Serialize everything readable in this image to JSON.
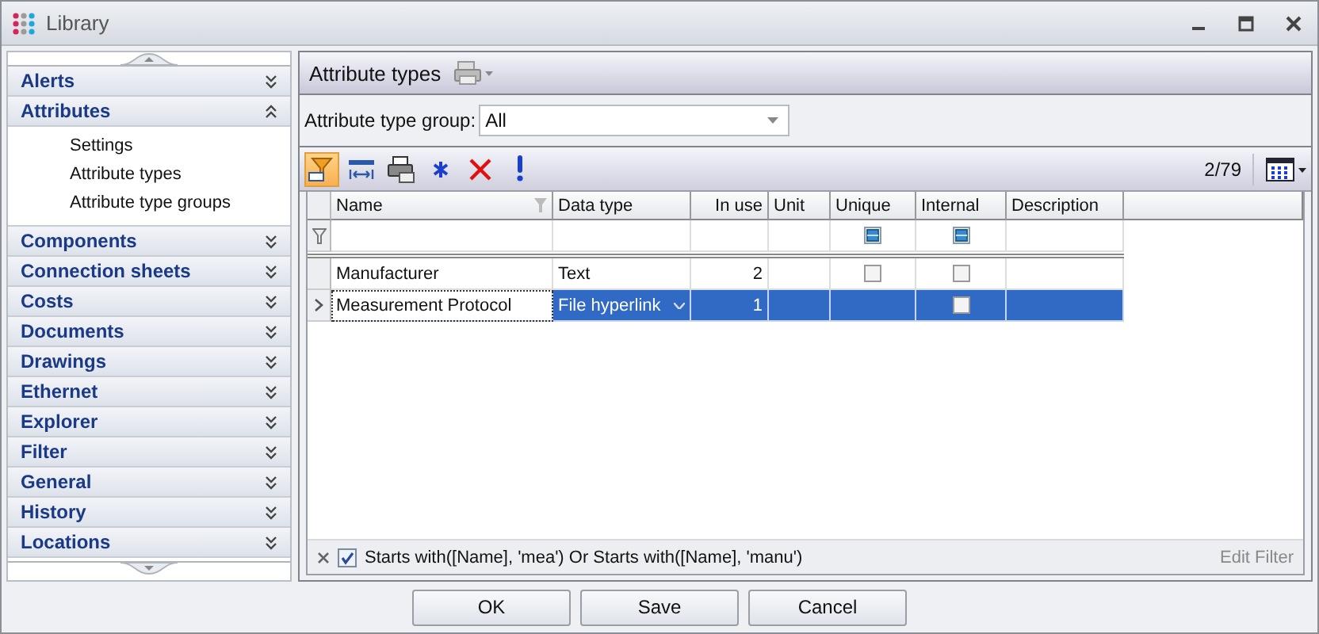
{
  "window": {
    "title": "Library"
  },
  "sidebar": {
    "groups": [
      {
        "label": "Alerts",
        "expanded": false
      },
      {
        "label": "Attributes",
        "expanded": true,
        "children": [
          {
            "label": "Settings"
          },
          {
            "label": "Attribute types"
          },
          {
            "label": "Attribute type groups"
          }
        ]
      },
      {
        "label": "Components",
        "expanded": false
      },
      {
        "label": "Connection sheets",
        "expanded": false
      },
      {
        "label": "Costs",
        "expanded": false
      },
      {
        "label": "Documents",
        "expanded": false
      },
      {
        "label": "Drawings",
        "expanded": false
      },
      {
        "label": "Ethernet",
        "expanded": false
      },
      {
        "label": "Explorer",
        "expanded": false
      },
      {
        "label": "Filter",
        "expanded": false
      },
      {
        "label": "General",
        "expanded": false
      },
      {
        "label": "History",
        "expanded": false
      },
      {
        "label": "Locations",
        "expanded": false
      }
    ]
  },
  "panel": {
    "title": "Attribute types",
    "group_filter": {
      "label": "Attribute type group:",
      "value": "All"
    },
    "toolbar": [
      {
        "kind": "filter",
        "selected": true
      },
      {
        "kind": "columns",
        "selected": false
      },
      {
        "kind": "print",
        "selected": false
      },
      {
        "kind": "asterisk",
        "selected": false
      },
      {
        "kind": "delete",
        "selected": false
      },
      {
        "kind": "exclamation",
        "selected": false
      }
    ],
    "record_count": "2/79",
    "table": {
      "columns": [
        {
          "label": "Name",
          "kind": "text",
          "filter_icon": true
        },
        {
          "label": "Data type",
          "kind": "text"
        },
        {
          "label": "In use",
          "kind": "number"
        },
        {
          "label": "Unit",
          "kind": "text"
        },
        {
          "label": "Unique",
          "kind": "check"
        },
        {
          "label": "Internal",
          "kind": "check"
        },
        {
          "label": "Description",
          "kind": "text"
        }
      ],
      "filter_row": {
        "unique": {
          "indeterminate": true
        },
        "internal": {
          "indeterminate": true
        }
      },
      "rows": [
        {
          "name": "Manufacturer",
          "data_type": "Text",
          "in_use": "2",
          "unique": {
            "checked": false
          },
          "internal": {
            "checked": false
          },
          "selected": false
        },
        {
          "name": "Measurement Protocol",
          "data_type": "File hyperlink",
          "in_use": "1",
          "internal": {
            "checked": false
          },
          "selected": true
        }
      ]
    },
    "filter_bar": {
      "enabled": true,
      "expression": "Starts with([Name], 'mea') Or Starts with([Name], 'manu')",
      "edit_link": "Edit Filter"
    }
  },
  "buttons": [
    "OK",
    "Save",
    "Cancel"
  ]
}
